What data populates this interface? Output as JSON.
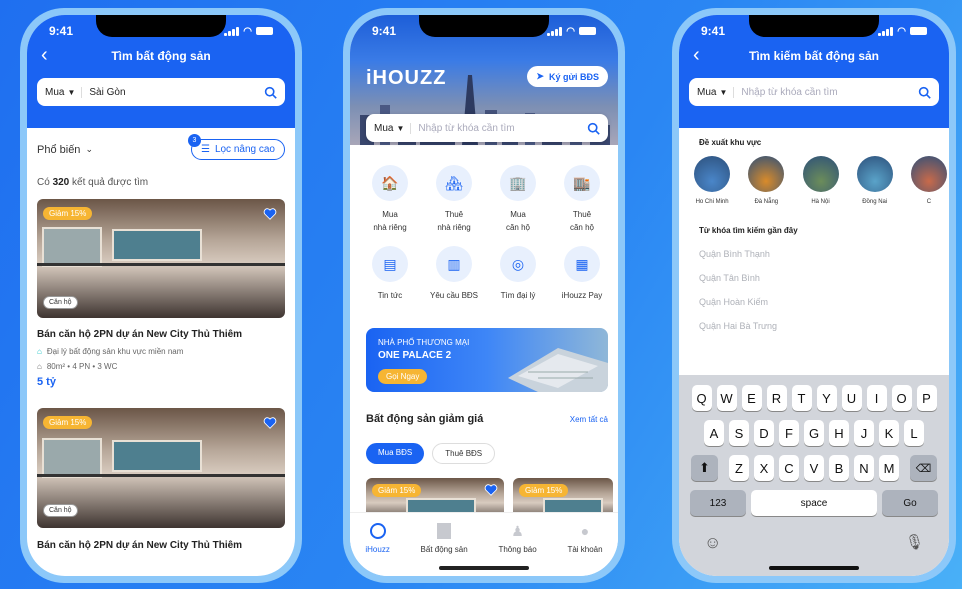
{
  "status": {
    "time": "9:41"
  },
  "left": {
    "title": "Tìm bất động sản",
    "mode": "Mua",
    "location": "Sài Gòn",
    "sort": "Phổ biến",
    "filter_label": "Lọc nâng cao",
    "filter_badge": "3",
    "result_prefix": "Có ",
    "result_count": "320",
    "result_suffix": " kết quả được tìm",
    "cards": [
      {
        "discount": "Giảm 15%",
        "type": "Căn hộ",
        "title": "Bán căn hộ 2PN dự án New City Thủ Thiêm",
        "agent": "Đại lý bất động sản khu vực miền nam",
        "specs": "80m² • 4 PN • 3 WC",
        "price": "5 tỷ"
      },
      {
        "discount": "Giảm 15%",
        "type": "Căn hộ",
        "title": "Bán căn hộ 2PN dự án New City Thủ Thiêm"
      }
    ]
  },
  "middle": {
    "logo": "iHOUZZ",
    "consign_button": "Ký gửi BĐS",
    "mode": "Mua",
    "search_placeholder": "Nhập từ khóa cần tìm",
    "services": [
      {
        "line1": "Mua",
        "line2": "nhà riêng",
        "icon": "house-cart-icon"
      },
      {
        "line1": "Thuê",
        "line2": "nhà riêng",
        "icon": "house-key-icon"
      },
      {
        "line1": "Mua",
        "line2": "căn hộ",
        "icon": "building-icon"
      },
      {
        "line1": "Thuê",
        "line2": "căn hộ",
        "icon": "apartment-key-icon"
      },
      {
        "line1": "Tin tức",
        "line2": "",
        "icon": "news-icon"
      },
      {
        "line1": "Yêu cầu BĐS",
        "line2": "",
        "icon": "request-icon"
      },
      {
        "line1": "Tìm đại lý",
        "line2": "",
        "icon": "agent-search-icon"
      },
      {
        "line1": "iHouzz Pay",
        "line2": "",
        "icon": "wallet-icon"
      }
    ],
    "banner": {
      "line1": "NHÀ PHỐ THƯƠNG MẠI",
      "line2": "ONE PALACE 2",
      "cta": "Gọi Ngay"
    },
    "section_title": "Bất động sản giảm giá",
    "see_all": "Xem tất cả",
    "tabs": [
      "Mua BĐS",
      "Thuê BĐS"
    ],
    "discount_tag": "Giảm 15%",
    "bottom_nav": [
      "iHouzz",
      "Bất động sản",
      "Thông báo",
      "Tài khoản"
    ]
  },
  "right": {
    "title": "Tìm kiếm bất động sản",
    "mode": "Mua",
    "search_placeholder": "Nhập từ khóa cần tìm",
    "suggest_title": "Đề xuất khu vực",
    "regions": [
      "Ho Chi Minh",
      "Đà Nẵng",
      "Hà Nội",
      "Đồng Nai",
      "C"
    ],
    "recent_title": "Từ khóa tìm kiếm gần đây",
    "recent": [
      "Quận Bình Thạnh",
      "Quận Tân Bình",
      "Quận Hoàn Kiếm",
      "Quận Hai Bà Trưng"
    ],
    "keyboard": {
      "row1": [
        "Q",
        "W",
        "E",
        "R",
        "T",
        "Y",
        "U",
        "I",
        "O",
        "P"
      ],
      "row2": [
        "A",
        "S",
        "D",
        "F",
        "G",
        "H",
        "J",
        "K",
        "L"
      ],
      "row3": [
        "Z",
        "X",
        "C",
        "V",
        "B",
        "N",
        "M"
      ],
      "numbers": "123",
      "space": "space",
      "go": "Go"
    }
  },
  "colors": {
    "primary": "#1a63f2",
    "accent": "#f6b533",
    "background": "#2a86f3"
  }
}
